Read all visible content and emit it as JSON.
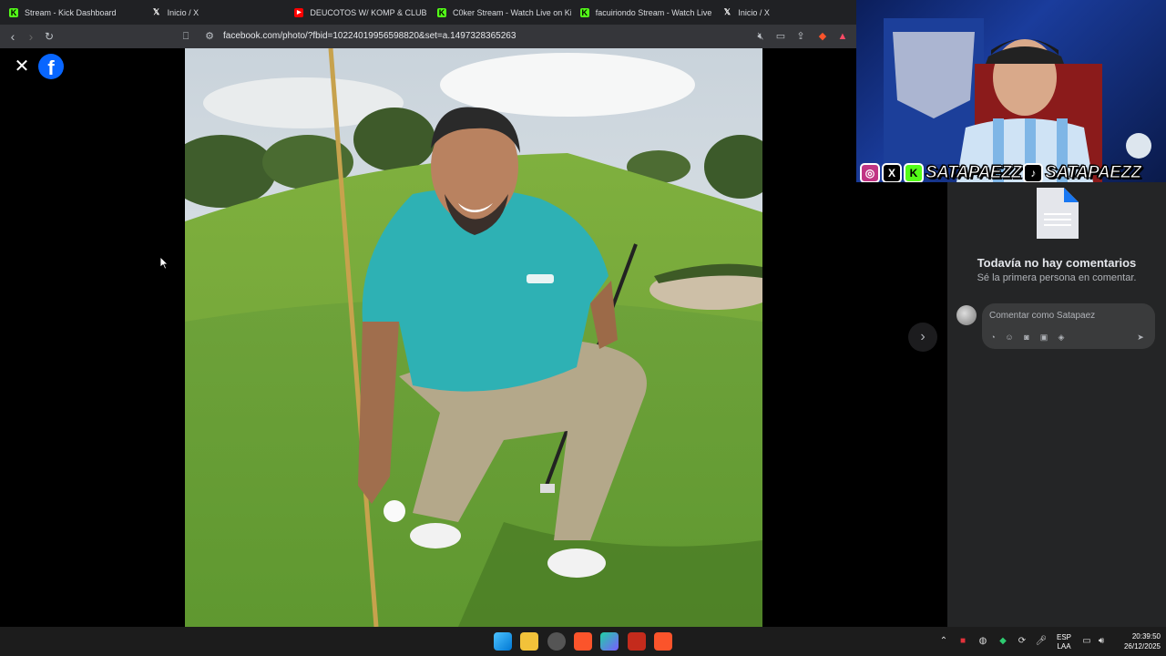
{
  "browser": {
    "tabs": [
      {
        "label": "Stream - Kick Dashboard",
        "icon": "kick-icon"
      },
      {
        "label": "Inicio / X",
        "icon": "x-icon"
      },
      {
        "label": "DEUCOTOS W/ KOMP & CLUB HATS",
        "icon": "youtube-icon"
      },
      {
        "label": "C0ker Stream - Watch Live on Kick",
        "icon": "kick-icon"
      },
      {
        "label": "facuiriondo Stream - Watch Live on K",
        "icon": "kick-icon"
      },
      {
        "label": "Inicio / X",
        "icon": "x-icon"
      }
    ],
    "url": "facebook.com/photo/?fbid=10224019956598820&set=a.1497328365263"
  },
  "viewer": {
    "close_icon": "close-icon",
    "logo": "facebook-logo",
    "next_icon": "chevron-right-icon"
  },
  "comments": {
    "empty_title": "Todavía no hay comentarios",
    "empty_subtitle": "Sé la primera persona en comentar.",
    "input_placeholder": "Comentar como Satapaez"
  },
  "overlay": {
    "handle_1": "SATAPAEZZ",
    "handle_2": "SATAPAEZZ"
  },
  "taskbar": {
    "lang_1": "ESP",
    "lang_2": "LAA",
    "time": "20:39:50",
    "date": "26/12/2025"
  },
  "colors": {
    "facebook_blue": "#0866ff",
    "kick_green": "#53fc18",
    "panel_bg": "#242526"
  }
}
